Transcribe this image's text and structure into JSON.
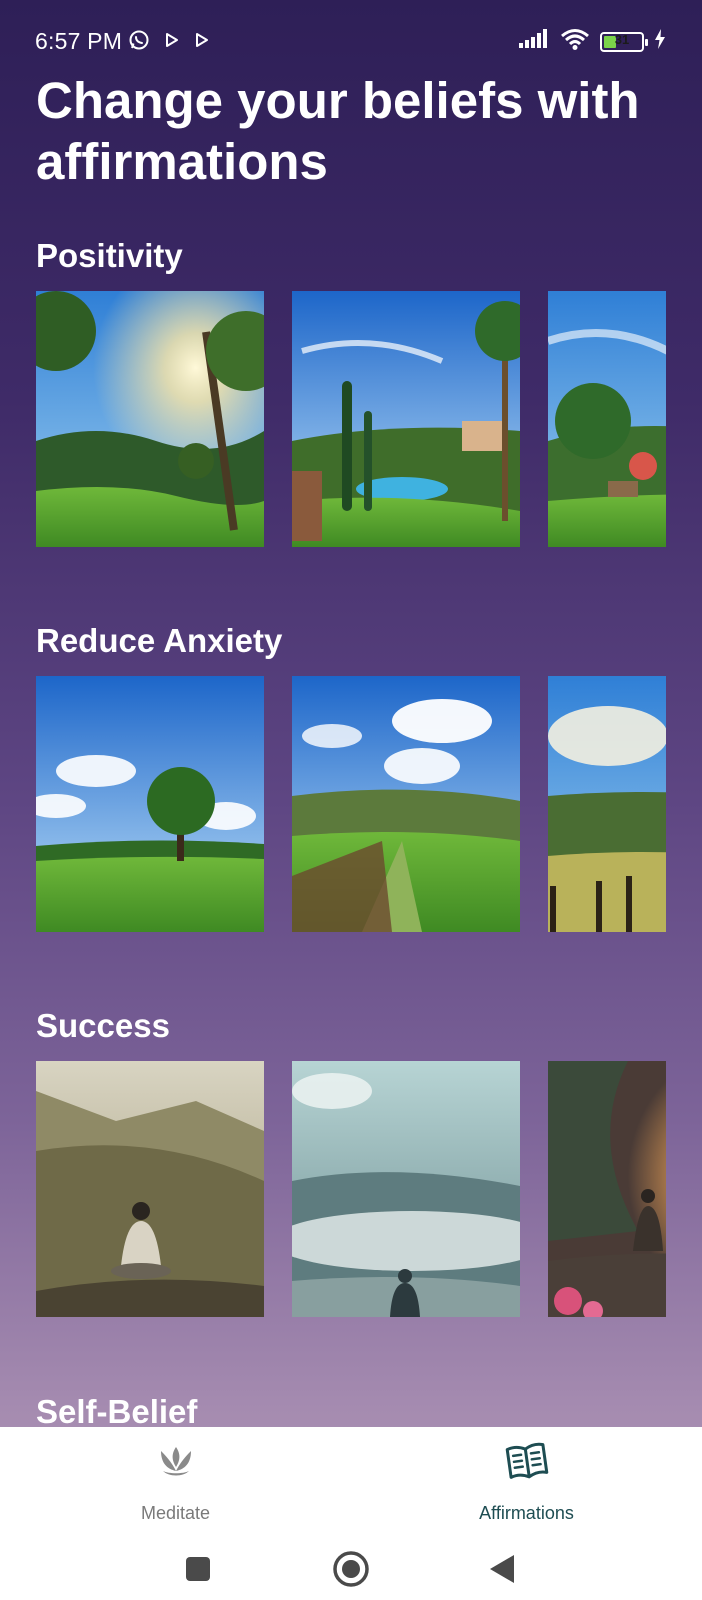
{
  "status_bar": {
    "time": "6:57 PM",
    "battery_level": "31",
    "icons": [
      "whatsapp-icon",
      "play-store-icon",
      "play-store-icon",
      "signal-icon",
      "wifi-icon",
      "battery-icon",
      "charging-icon"
    ]
  },
  "page": {
    "title": "Change your beliefs with affirmations"
  },
  "sections": [
    {
      "title": "Positivity",
      "thumbnails": [
        "garden-sunlight",
        "villa-pool-palms",
        "patio-garden"
      ]
    },
    {
      "title": "Reduce Anxiety",
      "thumbnails": [
        "lone-tree-meadow",
        "rolling-hills-path",
        "farm-fence-hills"
      ]
    },
    {
      "title": "Success",
      "thumbnails": [
        "meditating-man-mountains",
        "person-above-clouds",
        "meditating-sunset-flowers"
      ]
    },
    {
      "title": "Self-Belief"
    }
  ],
  "bottom_nav": {
    "items": [
      {
        "label": "Meditate",
        "icon": "lotus-icon",
        "selected": false
      },
      {
        "label": "Affirmations",
        "icon": "book-icon",
        "selected": true
      }
    ]
  },
  "colors": {
    "accent": "#1e4d52",
    "inactive": "#7a7a7a",
    "background_top": "#2e1f57",
    "background_bottom": "#b39cba"
  }
}
